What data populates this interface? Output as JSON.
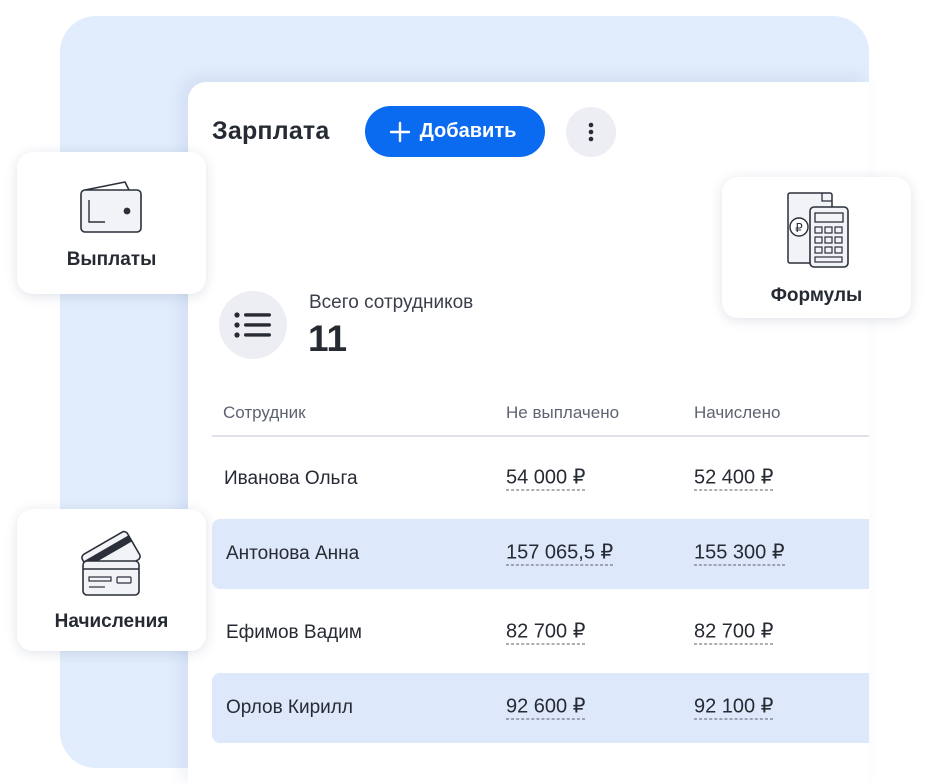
{
  "header": {
    "title": "Зарплата",
    "add_label": "Добавить"
  },
  "features": {
    "payouts": "Выплаты",
    "accruals": "Начисления",
    "formulas": "Формулы"
  },
  "summary": {
    "label": "Всего сотрудников",
    "value": "11"
  },
  "table": {
    "columns": [
      "Сотрудник",
      "Не выплачено",
      "Начислено"
    ],
    "rows": [
      {
        "name": "Иванова Ольга",
        "unpaid": "54 000 ₽",
        "accrued": "52 400 ₽"
      },
      {
        "name": "Антонова Анна",
        "unpaid": "157 065,5 ₽",
        "accrued": "155 300 ₽"
      },
      {
        "name": "Ефимов Вадим",
        "unpaid": "82 700 ₽",
        "accrued": "82 700 ₽"
      },
      {
        "name": "Орлов Кирилл",
        "unpaid": "92 600 ₽",
        "accrued": "92 100 ₽"
      }
    ]
  },
  "colors": {
    "accent": "#0a6af0",
    "panel_bg": "#e1ecfc",
    "row_highlight": "#dde8fb"
  },
  "icons": {
    "add": "plus-icon",
    "more": "more-vertical-icon",
    "summary": "list-icon",
    "payouts": "wallet-icon",
    "accruals": "credit-cards-icon",
    "formulas": "calculator-icon"
  }
}
